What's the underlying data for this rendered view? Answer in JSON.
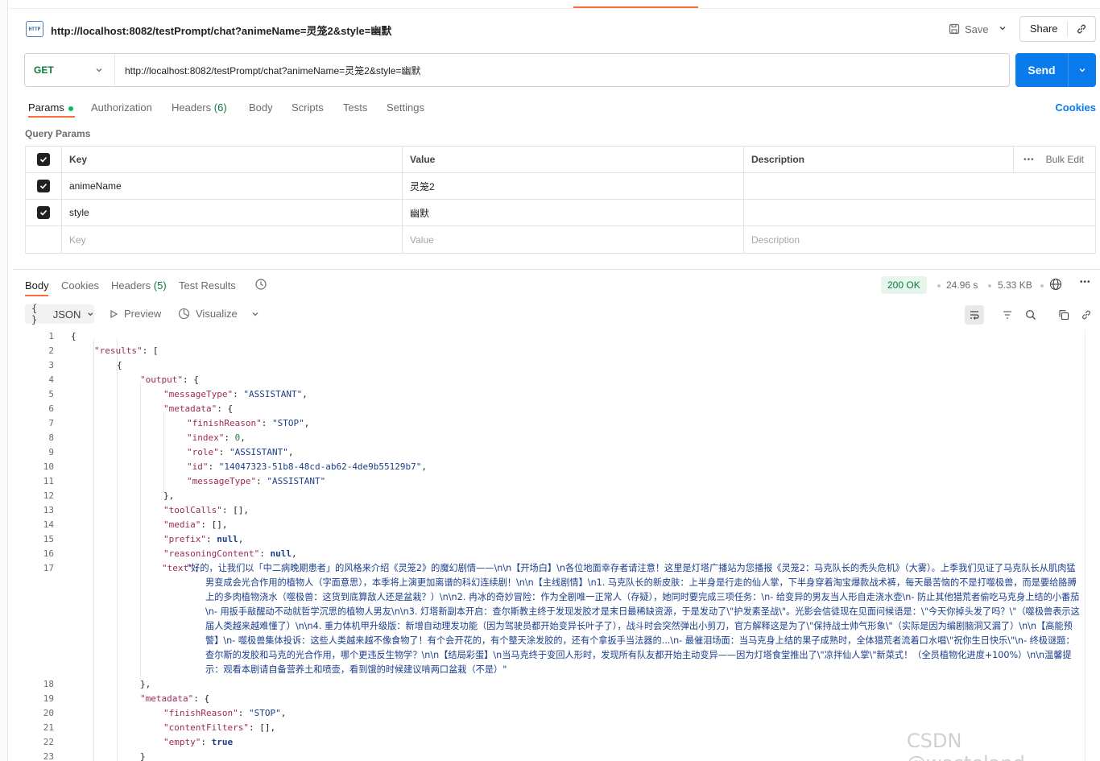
{
  "request": {
    "title": "http://localhost:8082/testPrompt/chat?animeName=灵笼2&style=幽默",
    "badge": "HTTP",
    "save_label": "Save",
    "share_label": "Share",
    "method": "GET",
    "url": "http://localhost:8082/testPrompt/chat?animeName=灵笼2&style=幽默",
    "send_label": "Send",
    "tabs": [
      "Params",
      "Authorization",
      "Headers",
      "(6)",
      "Body",
      "Scripts",
      "Tests",
      "Settings"
    ],
    "cookies_label": "Cookies"
  },
  "params": {
    "section_label": "Query Params",
    "headers": {
      "key": "Key",
      "value": "Value",
      "description": "Description",
      "bulk_edit": "Bulk Edit"
    },
    "rows": [
      {
        "key": "animeName",
        "value": "灵笼2",
        "description": ""
      },
      {
        "key": "style",
        "value": "幽默",
        "description": ""
      }
    ],
    "placeholders": {
      "key": "Key",
      "value": "Value",
      "description": "Description"
    }
  },
  "response": {
    "tabs": [
      "Body",
      "Cookies",
      "Headers",
      "(5)",
      "Test Results"
    ],
    "status": "200 OK",
    "time": "24.96 s",
    "size": "5.33 KB",
    "format_label": "JSON",
    "format_braces": "{ }",
    "preview_label": "Preview",
    "visualize_label": "Visualize"
  },
  "code": {
    "line_numbers": [
      "1",
      "2",
      "3",
      "4",
      "5",
      "6",
      "7",
      "8",
      "9",
      "10",
      "11",
      "12",
      "13",
      "14",
      "15",
      "16",
      "17",
      "18",
      "19",
      "20",
      "21",
      "22",
      "23"
    ],
    "l1": "{",
    "l2k": "\"results\"",
    "l2v": ": [",
    "l3": "{",
    "l4k": "\"output\"",
    "l4v": ": {",
    "l5k": "\"messageType\"",
    "l5v": "\"ASSISTANT\"",
    "l6k": "\"metadata\"",
    "l6v": ": {",
    "l7k": "\"finishReason\"",
    "l7v": "\"STOP\"",
    "l8k": "\"index\"",
    "l8v": "0",
    "l9k": "\"role\"",
    "l9v": "\"ASSISTANT\"",
    "l10k": "\"id\"",
    "l10v": "\"14047323-51b8-48cd-ab62-4de9b55129b7\"",
    "l11k": "\"messageType\"",
    "l11v": "\"ASSISTANT\"",
    "l12": "},",
    "l13k": "\"toolCalls\"",
    "l13v": ": [],",
    "l14k": "\"media\"",
    "l14v": ": [],",
    "l15k": "\"prefix\"",
    "l15v": "null",
    "l16k": "\"reasoningContent\"",
    "l16v": "null",
    "l17k": "\"text\"",
    "l17v": "\"好的，让我们以「中二病晚期患者」的风格来介绍《灵笼2》的魔幻剧情——\\n\\n【开场白】\\n各位地面幸存者请注意！这里是灯塔广播站为您播报《灵笼2：马克队长的秃头危机》（大雾）。上季我们见证了马克队长从肌肉猛男变成会光合作用的植物人（字面意思），本季将上演更加离谱的科幻连续剧！\\n\\n【主线剧情】\\n1. 马克队长的新皮肤：上半身是行走的仙人掌，下半身穿着淘宝爆款战术裤，每天最苦恼的不是打噬极兽，而是要给胳膊上的多肉植物浇水（噬极兽：这货到底算敌人还是盆栽？）\\n\\n2. 冉冰的奇妙冒险：作为全剧唯一正常人（存疑），她同时要完成三项任务：\\n- 给变异的男友当人形自走浇水壶\\n- 防止其他猎荒者偷吃马克身上结的小番茄\\n- 用扳手敲醒动不动就哲学沉思的植物人男友\\n\\n3. 灯塔新副本开启：查尔斯教主终于发现发胶才是末日最稀缺资源，于是发动了\\\"护发素圣战\\\"。光影会信徒现在见面问候语是：\\\"今天你掉头发了吗？\\\"（噬极兽表示这届人类越来越难懂了）\\n\\n4. 重力体机甲升级版：新增自动理发功能（因为驾驶员都开始变异长叶子了），战斗时会突然弹出小剪刀，官方解释这是为了\\\"保持战士帅气形象\\\"（实际是因为编剧脑洞又漏了）\\n\\n【高能预警】\\n- 噬极兽集体投诉：这些人类越来越不像食物了！有个会开花的，有个整天涂发胶的，还有个拿扳手当法器的...\\n- 最催泪场面：当马克身上结的果子成熟时，全体猎荒者流着口水唱\\\"祝你生日快乐\\\"\\n- 终极谜题：查尔斯的发胶和马克的光合作用，哪个更违反生物学？\\n\\n【结局彩蛋】\\n当马克终于变回人形时，发现所有队友都开始主动变异——因为灯塔食堂推出了\\\"凉拌仙人掌\\\"新菜式！（全员植物化进度+100%）\\n\\n温馨提示：观看本剧请自备营养土和喷壶，看到饿的时候建议啃两口盆栽（不是）\"",
    "l18": "},",
    "l19k": "\"metadata\"",
    "l19v": ": {",
    "l20k": "\"finishReason\"",
    "l20v": "\"STOP\"",
    "l21k": "\"contentFilters\"",
    "l21v": ": [],",
    "l22k": "\"empty\"",
    "l22v": "true",
    "l23": "}"
  },
  "watermark": "CSDN @wasteland~",
  "colors": {
    "accent": "#ff6c37",
    "send": "#097bed",
    "status_ok": "#0c7a3e"
  }
}
